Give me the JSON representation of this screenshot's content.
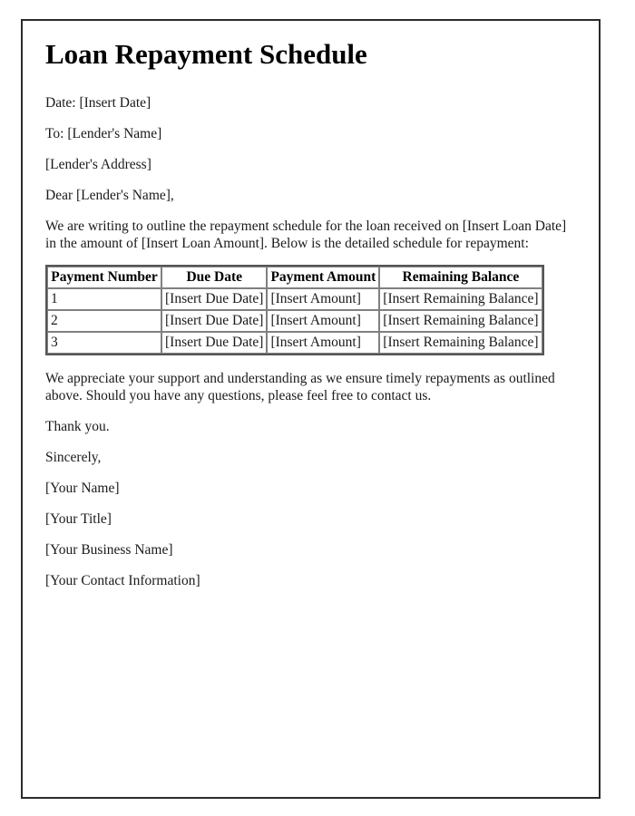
{
  "document": {
    "title": "Loan Repayment Schedule",
    "meta_lines": [
      "Date: [Insert Date]",
      "To: [Lender's Name]",
      "[Lender's Address]"
    ],
    "salutation": "Dear [Lender's Name],",
    "intro_paragraph": "We are writing to outline the repayment schedule for the loan received on [Insert Loan Date] in the amount of [Insert Loan Amount]. Below is the detailed schedule for repayment:",
    "closing_paragraph": "We appreciate your support and understanding as we ensure timely repayments as outlined above. Should you have any questions, please feel free to contact us.",
    "thanks": "Thank you.",
    "sign_off": "Sincerely,",
    "signature_lines": [
      "[Your Name]",
      "[Your Title]",
      "[Your Business Name]",
      "[Your Contact Information]"
    ]
  },
  "schedule_table": {
    "headers": [
      "Payment Number",
      "Due Date",
      "Payment Amount",
      "Remaining Balance"
    ],
    "rows": [
      [
        "1",
        "[Insert Due Date]",
        "[Insert Amount]",
        "[Insert Remaining Balance]"
      ],
      [
        "2",
        "[Insert Due Date]",
        "[Insert Amount]",
        "[Insert Remaining Balance]"
      ],
      [
        "3",
        "[Insert Due Date]",
        "[Insert Amount]",
        "[Insert Remaining Balance]"
      ]
    ]
  },
  "colors": {
    "text": "#1a1a1a",
    "heading": "#000000",
    "page_border": "#2b2b2b",
    "table_outer_border": "#555555",
    "table_cell_border": "#808080",
    "background": "#ffffff"
  }
}
